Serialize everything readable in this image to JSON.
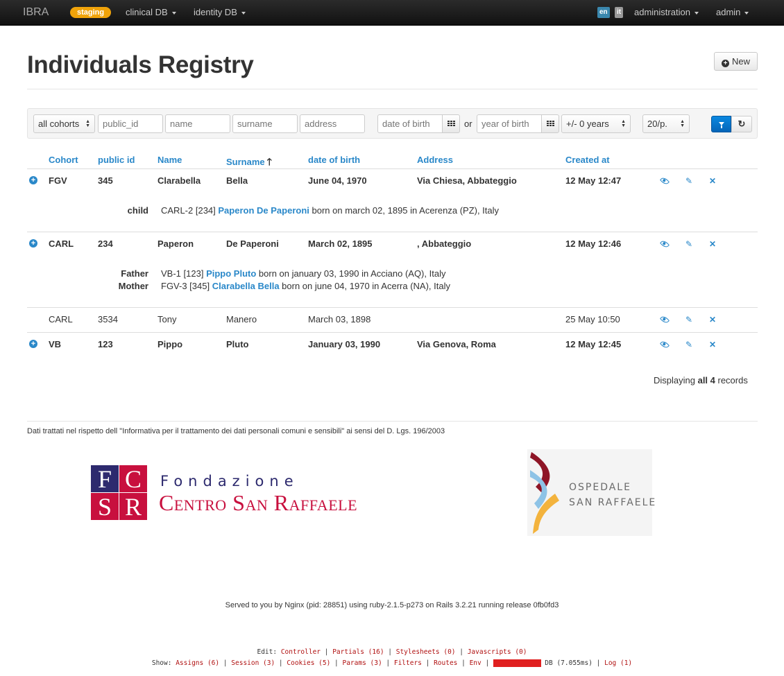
{
  "navbar": {
    "brand": "IBRA",
    "env_badge": "staging",
    "menus": [
      "clinical DB",
      "identity DB"
    ],
    "lang_en": "en",
    "lang_it": "it",
    "admin_menu": "administration",
    "user_menu": "admin"
  },
  "page": {
    "title": "Individuals Registry",
    "new_label": "New"
  },
  "filters": {
    "cohort_select": "all cohorts",
    "public_id_placeholder": "public_id",
    "name_placeholder": "name",
    "surname_placeholder": "surname",
    "address_placeholder": "address",
    "dob_placeholder": "date of birth",
    "or_label": "or",
    "yob_placeholder": "year of birth",
    "range_select": "+/- 0 years",
    "per_page_select": "20/p."
  },
  "table": {
    "headers": {
      "cohort": "Cohort",
      "public_id": "public id",
      "name": "Name",
      "surname": "Surname",
      "dob": "date of birth",
      "address": "Address",
      "created": "Created at"
    },
    "rows": [
      {
        "cohort": "FGV",
        "public_id": "345",
        "name": "Clarabella",
        "surname": "Bella",
        "dob": "June 04, 1970",
        "address": "Via Chiesa, Abbateggio",
        "created": "12 May 12:47",
        "relations": [
          {
            "label": "child",
            "prefix": "CARL-2 [234]",
            "name": "Paperon De Paperoni",
            "suffix": "born on march 02, 1895 in Acerenza (PZ), Italy"
          }
        ]
      },
      {
        "cohort": "CARL",
        "public_id": "234",
        "name": "Paperon",
        "surname": "De Paperoni",
        "dob": "March 02, 1895",
        "address": ", Abbateggio",
        "created": "12 May 12:46",
        "relations": [
          {
            "label": "Father",
            "prefix": "VB-1 [123]",
            "name": "Pippo Pluto",
            "suffix": "born on january 03, 1990 in Acciano (AQ), Italy"
          },
          {
            "label": "Mother",
            "prefix": "FGV-3 [345]",
            "name": "Clarabella Bella",
            "suffix": "born on june 04, 1970 in Acerra (NA), Italy"
          }
        ]
      },
      {
        "cohort": "CARL",
        "public_id": "3534",
        "name": "Tony",
        "surname": "Manero",
        "dob": "March 03, 1898",
        "address": "",
        "created": "25 May 10:50"
      },
      {
        "cohort": "VB",
        "public_id": "123",
        "name": "Pippo",
        "surname": "Pluto",
        "dob": "January 03, 1990",
        "address": "Via Genova, Roma",
        "created": "12 May 12:45"
      }
    ]
  },
  "pagination": {
    "prefix": "Displaying ",
    "bold": "all 4",
    "suffix": " records"
  },
  "footer": {
    "privacy": "Dati trattati nel rispetto dell \"Informativa per il trattamento dei dati personali comuni e sensibili\" ai sensi del D. Lgs. 196/2003",
    "fcsr_letters": [
      "F",
      "C",
      "S",
      "R"
    ],
    "fondazione": "Fondazione",
    "centro": "Centro San Raffaele",
    "ospedale_line1": "OSPEDALE",
    "ospedale_line2": "SAN RAFFAELE",
    "served": "Served to you by Nginx (pid: 28851) using ruby-2.1.5-p273 on Rails 3.2.21 running release 0fb0fd3"
  },
  "debug": {
    "edit_label": "Edit:",
    "edit_links": [
      "Controller",
      "Partials (16)",
      "Stylesheets (0)",
      "Javascripts (0)"
    ],
    "show_label": "Show:",
    "show_links": [
      "Assigns (6)",
      "Session (3)",
      "Cookies (5)",
      "Params (3)",
      "Filters",
      "Routes",
      "Env"
    ],
    "queries_link": "Queries (14)",
    "db_time": "DB (7.055ms)",
    "log_link": "Log (1)"
  },
  "colors": {
    "link": "#2a88c9",
    "staging_badge": "#f0a30a",
    "fcsr_blue": "#2d2a6e",
    "fcsr_red": "#c8103e"
  }
}
